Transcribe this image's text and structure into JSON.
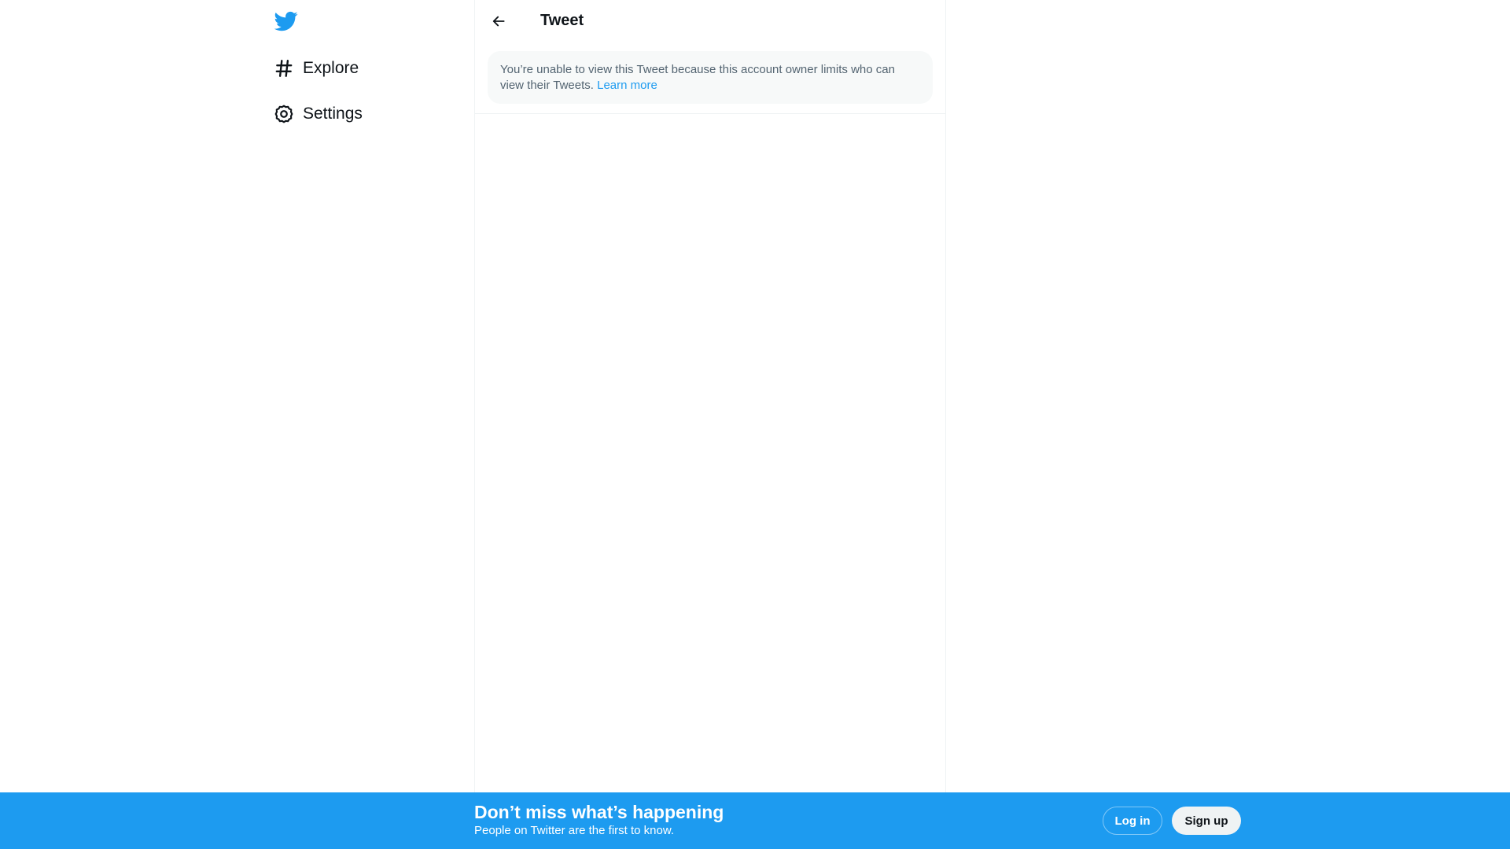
{
  "brand": {
    "accent": "#1d9bf0",
    "logo_icon": "twitter-bird-icon"
  },
  "sidebar": {
    "items": [
      {
        "label": "Explore",
        "icon": "hashtag-icon"
      },
      {
        "label": "Settings",
        "icon": "gear-icon"
      }
    ]
  },
  "header": {
    "title": "Tweet",
    "back_icon": "back-arrow-icon"
  },
  "notice": {
    "text": "You’re unable to view this Tweet because this account owner limits who can view their Tweets.",
    "link_label": "Learn more"
  },
  "bottom_bar": {
    "title": "Don’t miss what’s happening",
    "subtitle": "People on Twitter are the first to know.",
    "login_label": "Log in",
    "signup_label": "Sign up"
  }
}
